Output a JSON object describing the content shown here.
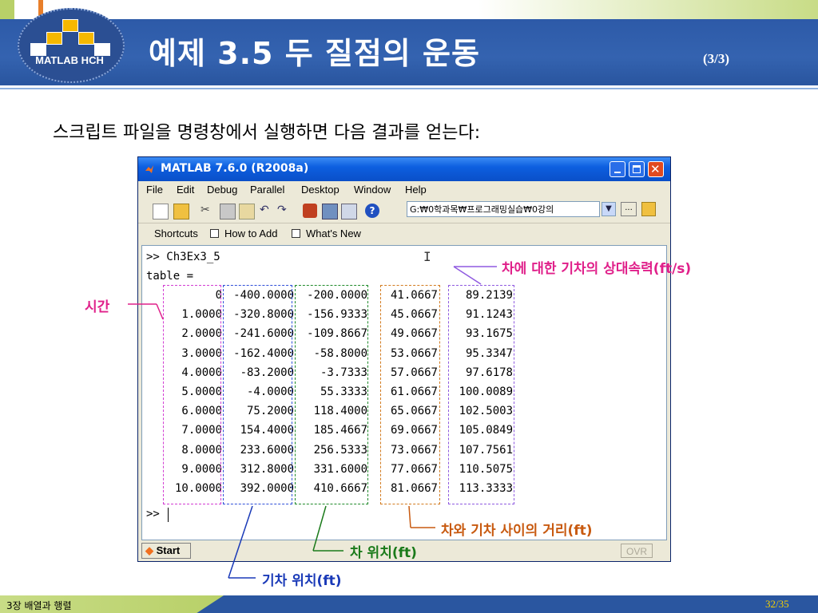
{
  "slide": {
    "logo_text": "MATLAB HCH",
    "title": "예제 3.5  두 질점의 운동",
    "page_indicator": "(3/3)",
    "subtitle": "스크립트 파일을 명령창에서 실행하면 다음 결과를 얻는다:",
    "footer_chapter": "3장 배열과 행렬",
    "footer_page": "32/35"
  },
  "window": {
    "title": "MATLAB  7.6.0 (R2008a)",
    "menu": [
      "File",
      "Edit",
      "Debug",
      "Parallel",
      "Desktop",
      "Window",
      "Help"
    ],
    "current_directory": "G:₩0학과목₩프로그래밍실습₩0강의",
    "shortcuts": [
      "Shortcuts",
      "How to Add",
      "What's New"
    ],
    "start_label": "Start",
    "status_ovr": "OVR"
  },
  "console": {
    "command_line": ">> Ch3Ex3_5",
    "table_label": "table =",
    "prompt": ">> ",
    "columns": {
      "time": [
        "0",
        "1.0000",
        "2.0000",
        "3.0000",
        "4.0000",
        "5.0000",
        "6.0000",
        "7.0000",
        "8.0000",
        "9.0000",
        "10.0000"
      ],
      "train_pos": [
        "-400.0000",
        "-320.8000",
        "-241.6000",
        "-162.4000",
        "-83.2000",
        "-4.0000",
        "75.2000",
        "154.4000",
        "233.6000",
        "312.8000",
        "392.0000"
      ],
      "car_pos": [
        "-200.0000",
        "-156.9333",
        "-109.8667",
        "-58.8000",
        "-3.7333",
        "55.3333",
        "118.4000",
        "185.4667",
        "256.5333",
        "331.6000",
        "410.6667"
      ],
      "distance": [
        "41.0667",
        "45.0667",
        "49.0667",
        "53.0667",
        "57.0667",
        "61.0667",
        "65.0667",
        "69.0667",
        "73.0667",
        "77.0667",
        "81.0667"
      ],
      "rel_speed": [
        "89.2139",
        "91.1243",
        "93.1675",
        "95.3347",
        "97.6178",
        "100.0089",
        "102.5003",
        "105.0849",
        "107.7561",
        "110.5075",
        "113.3333"
      ]
    }
  },
  "annotations": {
    "time": "시간",
    "rel_speed": "차에 대한 기차의 상대속력(ft/s)",
    "distance": "차와 기차 사이의 거리(ft)",
    "car_pos": "차 위치(ft)",
    "train_pos": "기차 위치(ft)"
  },
  "colors": {
    "time": "#d23cd2",
    "train_pos": "#2f4fd8",
    "car_pos": "#1f8a2a",
    "distance": "#d27a1e",
    "rel_speed": "#8f5ae0",
    "annotation_time": "#e0208a",
    "annotation_rel": "#e0208a",
    "annotation_dist": "#c85a10",
    "annotation_car": "#1a7a1a",
    "annotation_train": "#1a3ab8"
  }
}
